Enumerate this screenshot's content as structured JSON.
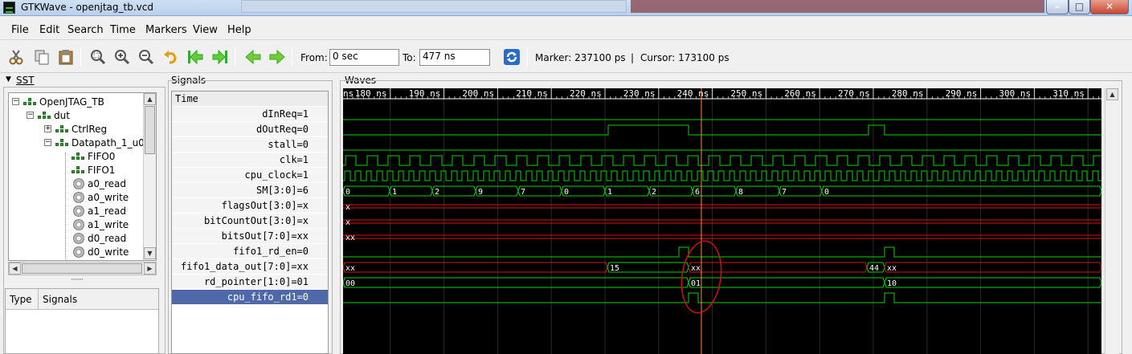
{
  "window": {
    "title": "GTKWave - openjtag_tb.vcd",
    "bg_window_1": "",
    "bg_window_2": ""
  },
  "menu": [
    "File",
    "Edit",
    "Search",
    "Time",
    "Markers",
    "View",
    "Help"
  ],
  "toolbar": {
    "from_label": "From:",
    "from_value": "0 sec",
    "to_label": "To:",
    "to_value": "477 ns",
    "marker_text": "Marker: 237100 ps",
    "separator": "|",
    "cursor_text": "Cursor: 173100 ps",
    "icons": [
      "cut-icon",
      "copy-icon",
      "paste-icon",
      "zoom-fit-icon",
      "zoom-in-icon",
      "zoom-out-icon",
      "undo-zoom-icon",
      "zoom-to-start-icon",
      "zoom-to-end-icon",
      "find-previous-edge-icon",
      "find-next-edge-icon",
      "reload-icon"
    ]
  },
  "sst": {
    "label": "SST",
    "tree": [
      {
        "label": "OpenJTAG_TB",
        "icon": "module-icon"
      },
      {
        "label": "dut",
        "icon": "module-icon"
      },
      {
        "label": "CtrlReg",
        "icon": "module-icon"
      },
      {
        "label": "Datapath_1_u0",
        "icon": "module-icon"
      },
      {
        "label": "FIFO0",
        "icon": "module-icon"
      },
      {
        "label": "FIFO1",
        "icon": "module-icon"
      },
      {
        "label": "a0_read",
        "icon": "process-icon"
      },
      {
        "label": "a0_write",
        "icon": "process-icon"
      },
      {
        "label": "a1_read",
        "icon": "process-icon"
      },
      {
        "label": "a1_write",
        "icon": "process-icon"
      },
      {
        "label": "d0_read",
        "icon": "process-icon"
      },
      {
        "label": "d0_write",
        "icon": "process-icon"
      }
    ],
    "columns": {
      "type": "Type",
      "signals": "Signals"
    }
  },
  "signals": {
    "label": "Signals",
    "header": "Time",
    "rows": [
      "dInReq=1",
      "dOutReq=0",
      "stall=0",
      "clk=1",
      "cpu_clock=1",
      "SM[3:0]=6",
      "flagsOut[3:0]=x",
      "bitCountOut[3:0]=x",
      "bitsOut[7:0]=xx",
      "fifo1_rd_en=0",
      "fifo1_data_out[7:0]=xx",
      "rd_pointer[1:0]=01",
      "cpu_fifo_rd1=0"
    ]
  },
  "waves": {
    "label": "Waves",
    "tick_labels": [
      "ns",
      "180 ns",
      "190 ns",
      "200 ns",
      "210 ns",
      "220 ns",
      "230 ns",
      "240 ns",
      "250 ns",
      "260 ns",
      "270 ns",
      "280 ns",
      "290 ns",
      "300 ns",
      "310 ns"
    ],
    "sm_values": [
      "0",
      "1",
      "2",
      "9",
      "7",
      "0",
      "1",
      "2",
      "6",
      "8",
      "7",
      "0"
    ],
    "flags_value": "x",
    "bitcount_value": "x",
    "bits_value": "xx",
    "fifo_data_values": [
      "xx",
      "15",
      "xx",
      "44",
      "xx"
    ],
    "rd_pointer_values": [
      "00",
      "01",
      "10"
    ],
    "colors": {
      "bus": "#00d800",
      "unknown": "#e01010",
      "cursor": "#ff8c5a",
      "grid": "#2a2a2a",
      "annotation": "#d01010"
    }
  }
}
